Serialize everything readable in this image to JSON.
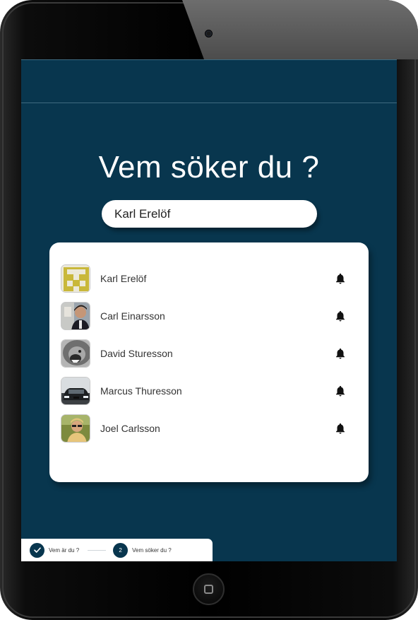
{
  "search": {
    "title": "Vem söker du ?",
    "query": "Karl Erelöf"
  },
  "results": [
    {
      "name": "Karl Erelöf",
      "avatar": "yellow-logo-avatar"
    },
    {
      "name": "Carl Einarsson",
      "avatar": "man-portrait-avatar"
    },
    {
      "name": "David Sturesson",
      "avatar": "lion-avatar"
    },
    {
      "name": "Marcus Thuresson",
      "avatar": "car-avatar"
    },
    {
      "name": "Joel Carlsson",
      "avatar": "sunglasses-avatar"
    }
  ],
  "stepper": {
    "steps": [
      {
        "number": "",
        "label": "Vem är du ?",
        "state": "completed",
        "icon": "check-icon"
      },
      {
        "number": "2",
        "label": "Vem söker du ?",
        "state": "current"
      }
    ]
  },
  "colors": {
    "background": "#08364e",
    "card": "#ffffff",
    "accent": "#08364e"
  }
}
